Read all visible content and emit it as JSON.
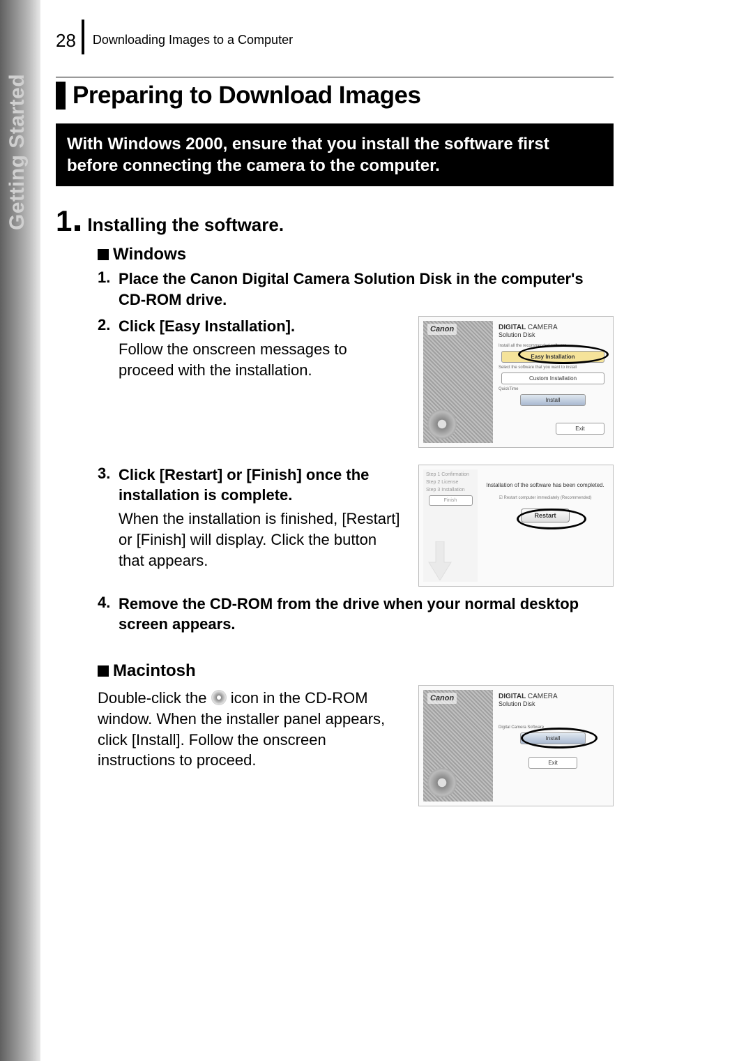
{
  "page_number": "28",
  "header_text": "Downloading Images to a Computer",
  "side_tab": "Getting Started",
  "section_title": "Preparing to Download Images",
  "warning_box": "With Windows 2000, ensure that you install the software first before connecting the camera to the computer.",
  "step1": {
    "num": "1",
    "title": "Installing the software."
  },
  "windows": {
    "heading": "Windows",
    "s1": {
      "num": "1.",
      "bold": "Place the Canon Digital Camera Solution Disk in the computer's CD-ROM drive."
    },
    "s2": {
      "num": "2.",
      "bold": "Click [Easy Installation].",
      "reg": "Follow the onscreen messages to proceed with the installation."
    },
    "s3": {
      "num": "3.",
      "bold": "Click [Restart] or [Finish] once the installation is complete.",
      "reg": "When the installation is finished, [Restart] or [Finish] will display. Click the button that appears."
    },
    "s4": {
      "num": "4.",
      "bold": "Remove the CD-ROM from the drive when your normal desktop screen appears."
    }
  },
  "macintosh": {
    "heading": "Macintosh",
    "text_a": "Double-click the ",
    "text_b": " icon in the CD-ROM window. When the installer panel appears, click [Install]. Follow the onscreen instructions to proceed."
  },
  "ss": {
    "canon": "Canon",
    "logo": "DIGITAL",
    "logo2": "CAMERA",
    "sub": "Solution Disk",
    "easy": "Easy Installation",
    "custom": "Custom Installation",
    "tiny1": "Install all the recommended software",
    "tiny2": "Select the software that you want to install",
    "quicktime": "QuickTime",
    "install": "Install",
    "exit": "Exit",
    "completed": "Installation of the software has been completed.",
    "restartnow": "Restart computer immediately (Recommended)",
    "restart": "Restart",
    "step1t": "Confirmation",
    "step2t": "License",
    "step3t": "Installation",
    "finish": "Finish"
  }
}
